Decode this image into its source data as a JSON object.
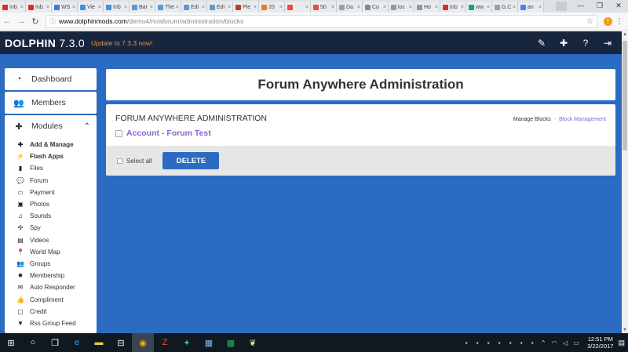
{
  "browser": {
    "tabs": [
      {
        "label": "Inb",
        "color": "#d93025"
      },
      {
        "label": "Inb",
        "color": "#d93025"
      },
      {
        "label": "WS",
        "color": "#3b7dd8"
      },
      {
        "label": "Vie",
        "color": "#4a90d9"
      },
      {
        "label": "Inb",
        "color": "#4a90d9"
      },
      {
        "label": "Bar",
        "color": "#5b9bd5"
      },
      {
        "label": "The",
        "color": "#5b9bd5"
      },
      {
        "label": "Edi",
        "color": "#5b9bd5"
      },
      {
        "label": "Edi",
        "color": "#5b9bd5"
      },
      {
        "label": "Ple",
        "color": "#c0392b"
      },
      {
        "label": "20",
        "color": "#e67e22"
      },
      {
        "label": "",
        "color": "#e74c3c"
      },
      {
        "label": "50",
        "color": "#e74c3c"
      },
      {
        "label": "Da",
        "color": "#95a5a6"
      },
      {
        "label": "Co",
        "color": "#7f8c8d"
      },
      {
        "label": "loc",
        "color": "#8e9aa6"
      },
      {
        "label": "Ho",
        "color": "#8e9aa6"
      },
      {
        "label": "Inb",
        "color": "#d93025"
      },
      {
        "label": "ww",
        "color": "#16a085"
      },
      {
        "label": "G.C",
        "color": "#95a5a6"
      },
      {
        "label": "an",
        "color": "#4285f4"
      }
    ],
    "url_domain": "www.dolphinmods.com",
    "url_path": "/demo4/m/aforum/administration/blocks",
    "window_controls": {
      "minimize": "—",
      "maximize": "❐",
      "close": "✕"
    }
  },
  "header": {
    "brand_name": "DOLPHIN",
    "brand_version": "7.3.0",
    "update_text": "Update to 7.3.3 now!",
    "icons": [
      "edit-icon",
      "puzzle-icon",
      "help-icon",
      "logout-icon"
    ]
  },
  "sidebar": {
    "dashboard": "Dashboard",
    "members": "Members",
    "modules": "Modules",
    "module_items": [
      {
        "label": "Add & Manage",
        "bold": true,
        "glyph": "✚",
        "icon": "plus-icon"
      },
      {
        "label": "Flash Apps",
        "bold": true,
        "glyph": "⚡",
        "icon": "bolt-icon"
      },
      {
        "label": "Files",
        "bold": false,
        "glyph": "▮",
        "icon": "file-icon"
      },
      {
        "label": "Forum",
        "bold": false,
        "glyph": "💬",
        "icon": "comments-icon"
      },
      {
        "label": "Payment",
        "bold": false,
        "glyph": "▭",
        "icon": "credit-card-icon"
      },
      {
        "label": "Photos",
        "bold": false,
        "glyph": "▣",
        "icon": "photo-icon"
      },
      {
        "label": "Sounds",
        "bold": false,
        "glyph": "♫",
        "icon": "music-icon"
      },
      {
        "label": "Spy",
        "bold": false,
        "glyph": "✣",
        "icon": "crosshairs-icon"
      },
      {
        "label": "Videos",
        "bold": false,
        "glyph": "▤",
        "icon": "film-icon"
      },
      {
        "label": "World Map",
        "bold": false,
        "glyph": "📍",
        "icon": "map-marker-icon"
      },
      {
        "label": "Groups",
        "bold": false,
        "glyph": "👥",
        "icon": "users-icon"
      },
      {
        "label": "Membership",
        "bold": false,
        "glyph": "✹",
        "icon": "certificate-icon"
      },
      {
        "label": "Auto Responder",
        "bold": false,
        "glyph": "✉",
        "icon": "envelope-icon"
      },
      {
        "label": "Compliment",
        "bold": false,
        "glyph": "👍",
        "icon": "thumbs-up-icon"
      },
      {
        "label": "Credit",
        "bold": false,
        "glyph": "▢",
        "icon": "money-icon"
      },
      {
        "label": "Rss Group Feed",
        "bold": false,
        "glyph": "▼",
        "icon": "filter-icon"
      }
    ]
  },
  "content": {
    "page_title": "Forum Anywhere Administration",
    "section_title": "FORUM ANYWHERE ADMINISTRATION",
    "link_manage_blocks": "Manage Blocks",
    "link_separator": "-",
    "link_block_management": "Block Management",
    "block_name": "Account - Forum Test",
    "select_all": "Select all",
    "delete_button": "DELETE"
  },
  "taskbar": {
    "time": "12:51 PM",
    "date": "3/22/2017"
  }
}
